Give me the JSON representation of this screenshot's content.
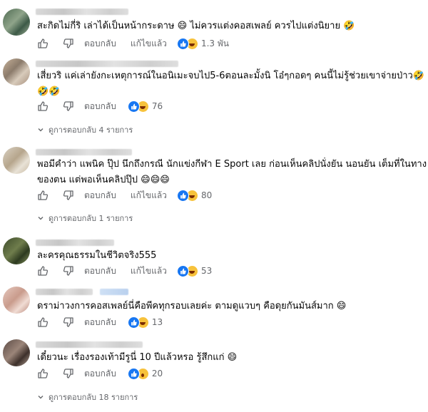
{
  "labels": {
    "reply": "ตอบกลับ",
    "edited": "แก้ไขแล้ว"
  },
  "icons": {
    "like": "thumbs-up-icon",
    "dislike": "thumbs-down-icon",
    "comment": "comment-bubble-icon"
  },
  "colors": {
    "like_blue": "#1877f2",
    "emoji_yellow": "#f7c23b",
    "meta_gray": "#65676b"
  },
  "comments": [
    {
      "lines": [
        "สะกิดไม่กี่ริ เล่าได้เป็นหน้ากระดาษ 😄 ไม่ควรแต่งคอสเพลย์ ควรไปแต่งนิยาย 🤣"
      ],
      "edited": true,
      "reactions": [
        "like",
        "haha"
      ],
      "count": "1.3 พัน",
      "replies": ""
    },
    {
      "lines": [
        "เสี่ยวริ แค่เล่ายังกะเหตุการณ์ในอนิเมะจบไป5-6ตอนละมั้งนิ โอ๋ๆกอดๆ คนนี้ไม่รู้ช่วยเขาจ่ายป่าว🤣",
        "🤣🤣"
      ],
      "edited": false,
      "reactions": [
        "like",
        "haha"
      ],
      "count": "76",
      "replies": "ดูการตอบกลับ 4 รายการ"
    },
    {
      "lines": [
        "พอมีคำว่า แพนิค ปุ๊ป นึกถึงกรณี นักแข่งกีฬา E Sport เลย ก่อนเห็นคลิปนั่งยัน นอนยัน เต็มที่ในทาง",
        "ของตน แต่พอเห็นคลิปปุ๊ป 😄😄😄"
      ],
      "edited": true,
      "reactions": [
        "like",
        "haha"
      ],
      "count": "80",
      "replies": "ดูการตอบกลับ 1 รายการ"
    },
    {
      "lines": [
        "ละครคุณธรรมในชีวิตจริง555"
      ],
      "edited": true,
      "reactions": [
        "like",
        "haha"
      ],
      "count": "53",
      "replies": ""
    },
    {
      "lines": [
        "ดราม่าวงการคอสเพลย์นี่คือพีคทุกรอบเลยค่ะ ตามดูแวบๆ คือดุยกันมันส์มาก 😄"
      ],
      "edited": false,
      "reactions": [
        "like",
        "haha"
      ],
      "count": "13",
      "replies": ""
    },
    {
      "lines": [
        "เดี๋ยวนะ เรื่องรองเท้ามีรูนี่ 10 ปีแล้วหรอ รู้สึกแก่ 😄"
      ],
      "edited": false,
      "reactions": [
        "like",
        "wow"
      ],
      "count": "20",
      "replies": "ดูการตอบกลับ 18 รายการ"
    }
  ]
}
